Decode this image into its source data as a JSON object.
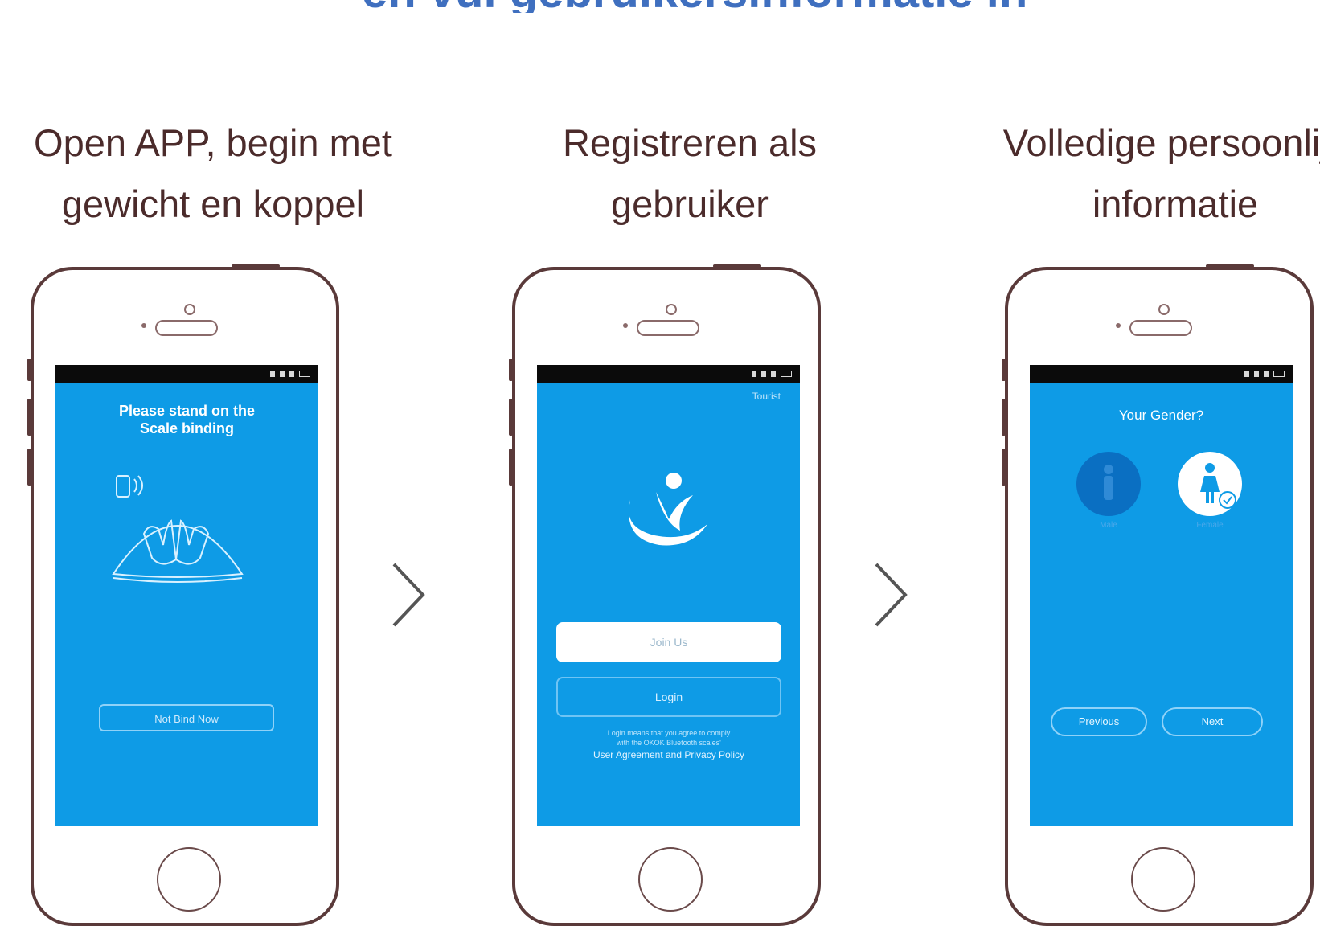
{
  "header": {
    "title_partial": "en vul gebruikersinformatie in"
  },
  "steps": [
    {
      "caption_line1": "Open APP, begin met",
      "caption_line2": "gewicht en koppel"
    },
    {
      "caption_line1": "Registreren als",
      "caption_line2": "gebruiker"
    },
    {
      "caption_line1": "Volledige persoonlijk",
      "caption_line2": "informatie"
    }
  ],
  "screen1": {
    "title_line1": "Please stand on the",
    "title_line2": "Scale binding",
    "skip_button": "Not Bind Now"
  },
  "screen2": {
    "skip_link": "Tourist",
    "join_button": "Join Us",
    "login_button": "Login",
    "terms_text_line1": "Login means that you agree to comply",
    "terms_text_line2": "with the OKOK Bluetooth scales'",
    "terms_link": "User Agreement and Privacy Policy"
  },
  "screen3": {
    "title": "Your Gender?",
    "male_label": "Male",
    "female_label": "Female",
    "previous_button": "Previous",
    "next_button": "Next"
  },
  "colors": {
    "screen_blue": "#0e9be6",
    "heading_blue": "#3f6fbf",
    "caption_brown": "#4b2b2b"
  }
}
